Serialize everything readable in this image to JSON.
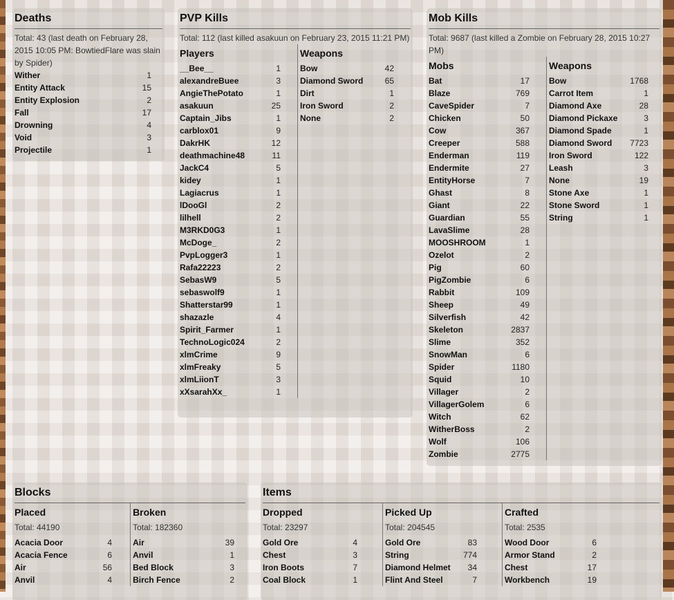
{
  "deaths": {
    "title": "Deaths",
    "total": "Total: 43 (last death on February 28, 2015 10:05 PM: BowtiedFlare was slain by Spider)",
    "rows": [
      {
        "name": "Wither",
        "value": "1"
      },
      {
        "name": "Entity Attack",
        "value": "15"
      },
      {
        "name": "Entity Explosion",
        "value": "2"
      },
      {
        "name": "Fall",
        "value": "17"
      },
      {
        "name": "Drowning",
        "value": "4"
      },
      {
        "name": "Void",
        "value": "3"
      },
      {
        "name": "Projectile",
        "value": "1"
      }
    ]
  },
  "pvp": {
    "title": "PVP Kills",
    "total": "Total: 112 (last killed asakuun on February 23, 2015 11:21 PM)",
    "players_label": "Players",
    "weapons_label": "Weapons",
    "players": [
      {
        "name": "__Bee__",
        "value": "1"
      },
      {
        "name": "alexandreBuee",
        "value": "3"
      },
      {
        "name": "AngieThePotato",
        "value": "1"
      },
      {
        "name": "asakuun",
        "value": "25"
      },
      {
        "name": "Captain_Jibs",
        "value": "1"
      },
      {
        "name": "carblox01",
        "value": "9"
      },
      {
        "name": "DakrHK",
        "value": "12"
      },
      {
        "name": "deathmachine48",
        "value": "11"
      },
      {
        "name": "JackC4",
        "value": "5"
      },
      {
        "name": "kidey",
        "value": "1"
      },
      {
        "name": "Lagiacrus",
        "value": "1"
      },
      {
        "name": "lDooGl",
        "value": "2"
      },
      {
        "name": "lilhell",
        "value": "2"
      },
      {
        "name": "M3RKD0G3",
        "value": "1"
      },
      {
        "name": "McDoge_",
        "value": "2"
      },
      {
        "name": "PvpLogger3",
        "value": "1"
      },
      {
        "name": "Rafa22223",
        "value": "2"
      },
      {
        "name": "SebasW9",
        "value": "5"
      },
      {
        "name": "sebaswolf9",
        "value": "1"
      },
      {
        "name": "Shatterstar99",
        "value": "1"
      },
      {
        "name": "shazazle",
        "value": "4"
      },
      {
        "name": "Spirit_Farmer",
        "value": "1"
      },
      {
        "name": "TechnoLogic024",
        "value": "2"
      },
      {
        "name": "xlmCrime",
        "value": "9"
      },
      {
        "name": "xlmFreaky",
        "value": "5"
      },
      {
        "name": "xlmLiionT",
        "value": "3"
      },
      {
        "name": "xXsarahXx_",
        "value": "1"
      }
    ],
    "weapons": [
      {
        "name": "Bow",
        "value": "42"
      },
      {
        "name": "Diamond Sword",
        "value": "65"
      },
      {
        "name": "Dirt",
        "value": "1"
      },
      {
        "name": "Iron Sword",
        "value": "2"
      },
      {
        "name": "None",
        "value": "2"
      }
    ]
  },
  "mobs": {
    "title": "Mob Kills",
    "total": "Total: 9687 (last killed a Zombie on February 28, 2015 10:27 PM)",
    "mobs_label": "Mobs",
    "weapons_label": "Weapons",
    "mobs": [
      {
        "name": "Bat",
        "value": "17"
      },
      {
        "name": "Blaze",
        "value": "769"
      },
      {
        "name": "CaveSpider",
        "value": "7"
      },
      {
        "name": "Chicken",
        "value": "50"
      },
      {
        "name": "Cow",
        "value": "367"
      },
      {
        "name": "Creeper",
        "value": "588"
      },
      {
        "name": "Enderman",
        "value": "119"
      },
      {
        "name": "Endermite",
        "value": "27"
      },
      {
        "name": "EntityHorse",
        "value": "7"
      },
      {
        "name": "Ghast",
        "value": "8"
      },
      {
        "name": "Giant",
        "value": "22"
      },
      {
        "name": "Guardian",
        "value": "55"
      },
      {
        "name": "LavaSlime",
        "value": "28"
      },
      {
        "name": "MOOSHROOM",
        "value": "1"
      },
      {
        "name": "Ozelot",
        "value": "2"
      },
      {
        "name": "Pig",
        "value": "60"
      },
      {
        "name": "PigZombie",
        "value": "6"
      },
      {
        "name": "Rabbit",
        "value": "109"
      },
      {
        "name": "Sheep",
        "value": "49"
      },
      {
        "name": "Silverfish",
        "value": "42"
      },
      {
        "name": "Skeleton",
        "value": "2837"
      },
      {
        "name": "Slime",
        "value": "352"
      },
      {
        "name": "SnowMan",
        "value": "6"
      },
      {
        "name": "Spider",
        "value": "1180"
      },
      {
        "name": "Squid",
        "value": "10"
      },
      {
        "name": "Villager",
        "value": "2"
      },
      {
        "name": "VillagerGolem",
        "value": "6"
      },
      {
        "name": "Witch",
        "value": "62"
      },
      {
        "name": "WitherBoss",
        "value": "2"
      },
      {
        "name": "Wolf",
        "value": "106"
      },
      {
        "name": "Zombie",
        "value": "2775"
      }
    ],
    "weapons": [
      {
        "name": "Bow",
        "value": "1768"
      },
      {
        "name": "Carrot Item",
        "value": "1"
      },
      {
        "name": "Diamond Axe",
        "value": "28"
      },
      {
        "name": "Diamond Pickaxe",
        "value": "3"
      },
      {
        "name": "Diamond Spade",
        "value": "1"
      },
      {
        "name": "Diamond Sword",
        "value": "7723"
      },
      {
        "name": "Iron Sword",
        "value": "122"
      },
      {
        "name": "Leash",
        "value": "3"
      },
      {
        "name": "None",
        "value": "19"
      },
      {
        "name": "Stone Axe",
        "value": "1"
      },
      {
        "name": "Stone Sword",
        "value": "1"
      },
      {
        "name": "String",
        "value": "1"
      }
    ]
  },
  "blocks": {
    "title": "Blocks",
    "placed": {
      "label": "Placed",
      "total": "Total: 44190",
      "rows": [
        {
          "name": "Acacia Door",
          "value": "4"
        },
        {
          "name": "Acacia Fence",
          "value": "6"
        },
        {
          "name": "Air",
          "value": "56"
        },
        {
          "name": "Anvil",
          "value": "4"
        }
      ]
    },
    "broken": {
      "label": "Broken",
      "total": "Total: 182360",
      "rows": [
        {
          "name": "Air",
          "value": "39"
        },
        {
          "name": "Anvil",
          "value": "1"
        },
        {
          "name": "Bed Block",
          "value": "3"
        },
        {
          "name": "Birch Fence",
          "value": "2"
        }
      ]
    }
  },
  "items": {
    "title": "Items",
    "dropped": {
      "label": "Dropped",
      "total": "Total: 23297",
      "rows": [
        {
          "name": "Gold Ore",
          "value": "4"
        },
        {
          "name": "Chest",
          "value": "3"
        },
        {
          "name": "Iron Boots",
          "value": "7"
        },
        {
          "name": "Coal Block",
          "value": "1"
        }
      ]
    },
    "picked_up": {
      "label": "Picked Up",
      "total": "Total: 204545",
      "rows": [
        {
          "name": "Gold Ore",
          "value": "83"
        },
        {
          "name": "String",
          "value": "774"
        },
        {
          "name": "Diamond Helmet",
          "value": "34"
        },
        {
          "name": "Flint And Steel",
          "value": "7"
        }
      ]
    },
    "crafted": {
      "label": "Crafted",
      "total": "Total: 2535",
      "rows": [
        {
          "name": "Wood Door",
          "value": "6"
        },
        {
          "name": "Armor Stand",
          "value": "2"
        },
        {
          "name": "Chest",
          "value": "17"
        },
        {
          "name": "Workbench",
          "value": "19"
        }
      ]
    }
  }
}
